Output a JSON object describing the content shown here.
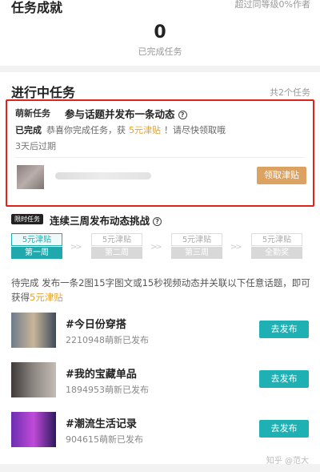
{
  "achievement": {
    "title": "任务成就",
    "rank_text": "超过同等级0%作者",
    "count": "0",
    "count_label": "已完成任务"
  },
  "in_progress": {
    "title": "进行中任务",
    "total": "共2个任务"
  },
  "task1": {
    "tag": "萌新任务",
    "name": "参与话题并发布一条动态",
    "status": "已完成",
    "message_pre": "恭喜你完成任务，获",
    "reward": "5元津贴",
    "message_post": "！请尽快领取哦",
    "expiry": "3天后过期",
    "claim_label": "领取津贴"
  },
  "task2": {
    "tag": "限时任务",
    "name": "连续三周发布动态挑战",
    "weeks": [
      {
        "amount": "5元津贴",
        "label": "第一周",
        "active": true
      },
      {
        "amount": "5元津贴",
        "label": "第二周",
        "active": false
      },
      {
        "amount": "5元津贴",
        "label": "第三周",
        "active": false
      },
      {
        "amount": "5元津贴",
        "label": "全勤奖",
        "active": false
      }
    ],
    "desc_pre": "待完成  发布一条2图15字图文或15秒视频动态并关联以下任意话题，即可获得",
    "desc_reward": "5元津贴"
  },
  "topics": [
    {
      "name": "#今日份穿搭",
      "count": "2210948萌新已发布",
      "button": "去发布",
      "colors": [
        "#6d7b8c",
        "#c9b59a",
        "#3d4a5a"
      ]
    },
    {
      "name": "#我的宝藏单品",
      "count": "1894953萌新已发布",
      "button": "去发布",
      "colors": [
        "#3e3a38",
        "#8d8783",
        "#c4bdb5"
      ]
    },
    {
      "name": "#潮流生活记录",
      "count": "904615萌新已发布",
      "button": "去发布",
      "colors": [
        "#6a2fb0",
        "#c14ad8",
        "#2a1a5c"
      ]
    }
  ],
  "watermark": "知乎 @范大"
}
